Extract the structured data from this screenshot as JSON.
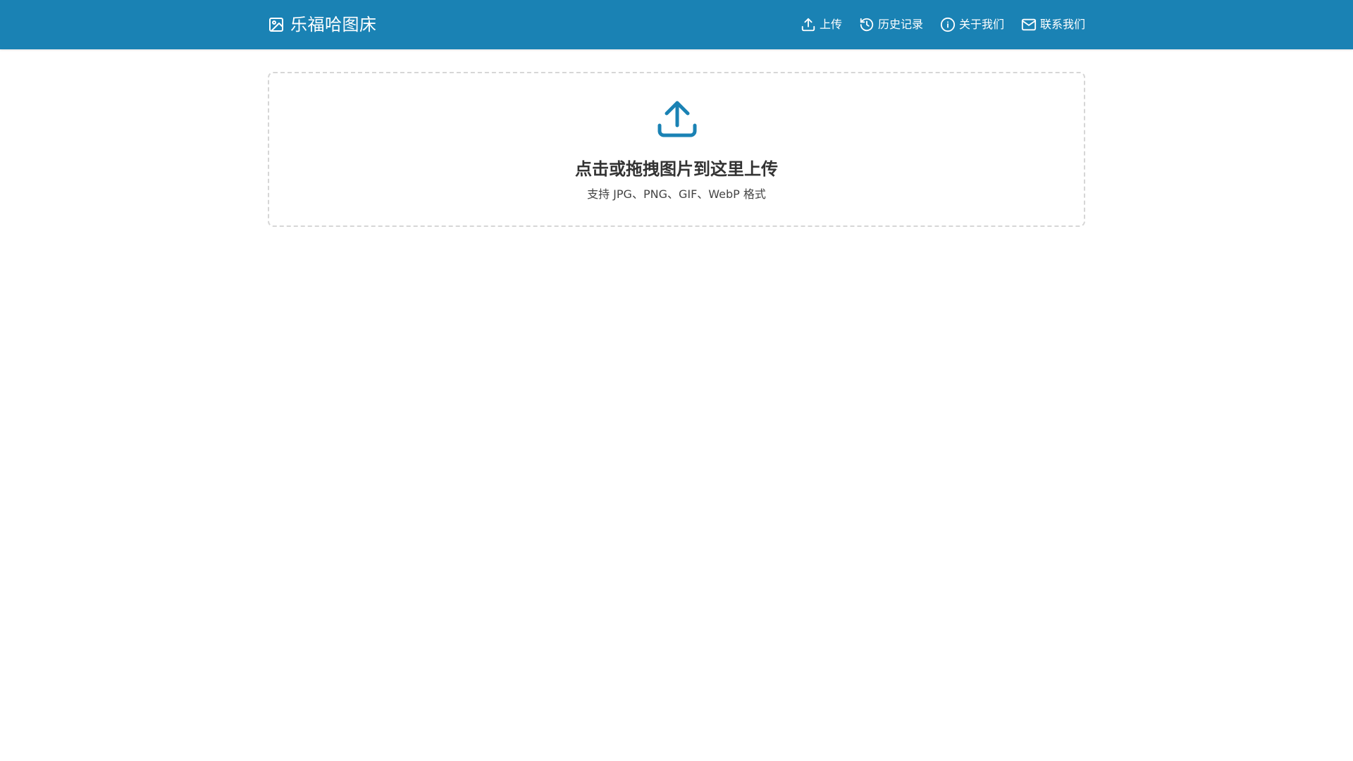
{
  "brand": {
    "title": "乐福哈图床",
    "icon": "image-icon"
  },
  "nav": {
    "items": [
      {
        "label": "上传",
        "icon": "upload-icon"
      },
      {
        "label": "历史记录",
        "icon": "history-icon"
      },
      {
        "label": "关于我们",
        "icon": "info-icon"
      },
      {
        "label": "联系我们",
        "icon": "mail-icon"
      }
    ]
  },
  "upload": {
    "icon": "upload-icon",
    "title": "点击或拖拽图片到这里上传",
    "subtitle": "支持 JPG、PNG、GIF、WebP 格式"
  },
  "colors": {
    "header_bg": "#1a82b4",
    "accent": "#1a82b4",
    "dashed_border": "#d6d6d6"
  }
}
